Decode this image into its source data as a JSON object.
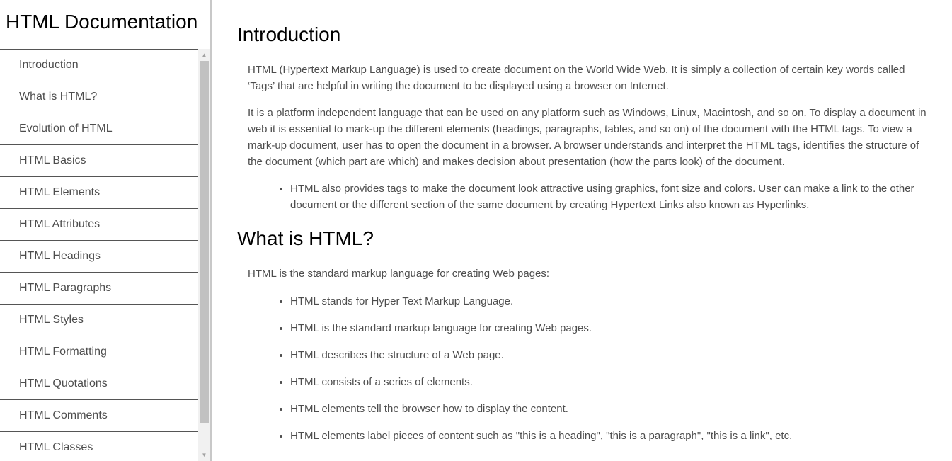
{
  "sidebar": {
    "title": "HTML Documentation",
    "items": [
      {
        "label": "Introduction"
      },
      {
        "label": "What is HTML?"
      },
      {
        "label": "Evolution of HTML"
      },
      {
        "label": "HTML Basics"
      },
      {
        "label": "HTML Elements"
      },
      {
        "label": "HTML Attributes"
      },
      {
        "label": "HTML Headings"
      },
      {
        "label": "HTML Paragraphs"
      },
      {
        "label": "HTML Styles"
      },
      {
        "label": "HTML Formatting"
      },
      {
        "label": "HTML Quotations"
      },
      {
        "label": "HTML Comments"
      },
      {
        "label": "HTML Classes"
      }
    ],
    "scrollbar": {
      "up_icon": "triangle-up-icon",
      "down_icon": "triangle-down-icon"
    }
  },
  "main": {
    "introduction": {
      "title": "Introduction",
      "paragraph_1": "HTML (Hypertext Markup Language) is used to create document on the World Wide Web. It is simply a collection of certain key words called ‘Tags’ that are helpful in writing the document to be displayed using a browser on Internet.",
      "paragraph_2": "It is a platform independent language that can be used on any platform such as Windows, Linux, Macintosh, and so on. To display a document in web it is essential to mark-up the different elements (headings, paragraphs, tables, and so on) of the document with the HTML tags. To view a mark-up document, user has to open the document in a browser. A browser understands and interpret the HTML tags, identifies the structure of the document (which part are which) and makes decision about presentation (how the parts look) of the document.",
      "bullets": [
        "HTML also provides tags to make the document look attractive using graphics, font size and colors. User can make a link to the other document or the different section of the same document by creating Hypertext Links also known as Hyperlinks."
      ]
    },
    "what_is_html": {
      "title": "What is HTML?",
      "intro": "HTML is the standard markup language for creating Web pages:",
      "bullets": [
        "HTML stands for Hyper Text Markup Language.",
        "HTML is the standard markup language for creating Web pages.",
        "HTML describes the structure of a Web page.",
        "HTML consists of a series of elements.",
        "HTML elements tell the browser how to display the content.",
        "HTML elements label pieces of content such as \"this is a heading\", \"this is a paragraph\", \"this is a link\", etc."
      ]
    }
  },
  "colors": {
    "text": "#4d4d4d",
    "heading": "#000000",
    "divider": "#555555",
    "scrollbar_thumb": "#c1c1c1"
  }
}
